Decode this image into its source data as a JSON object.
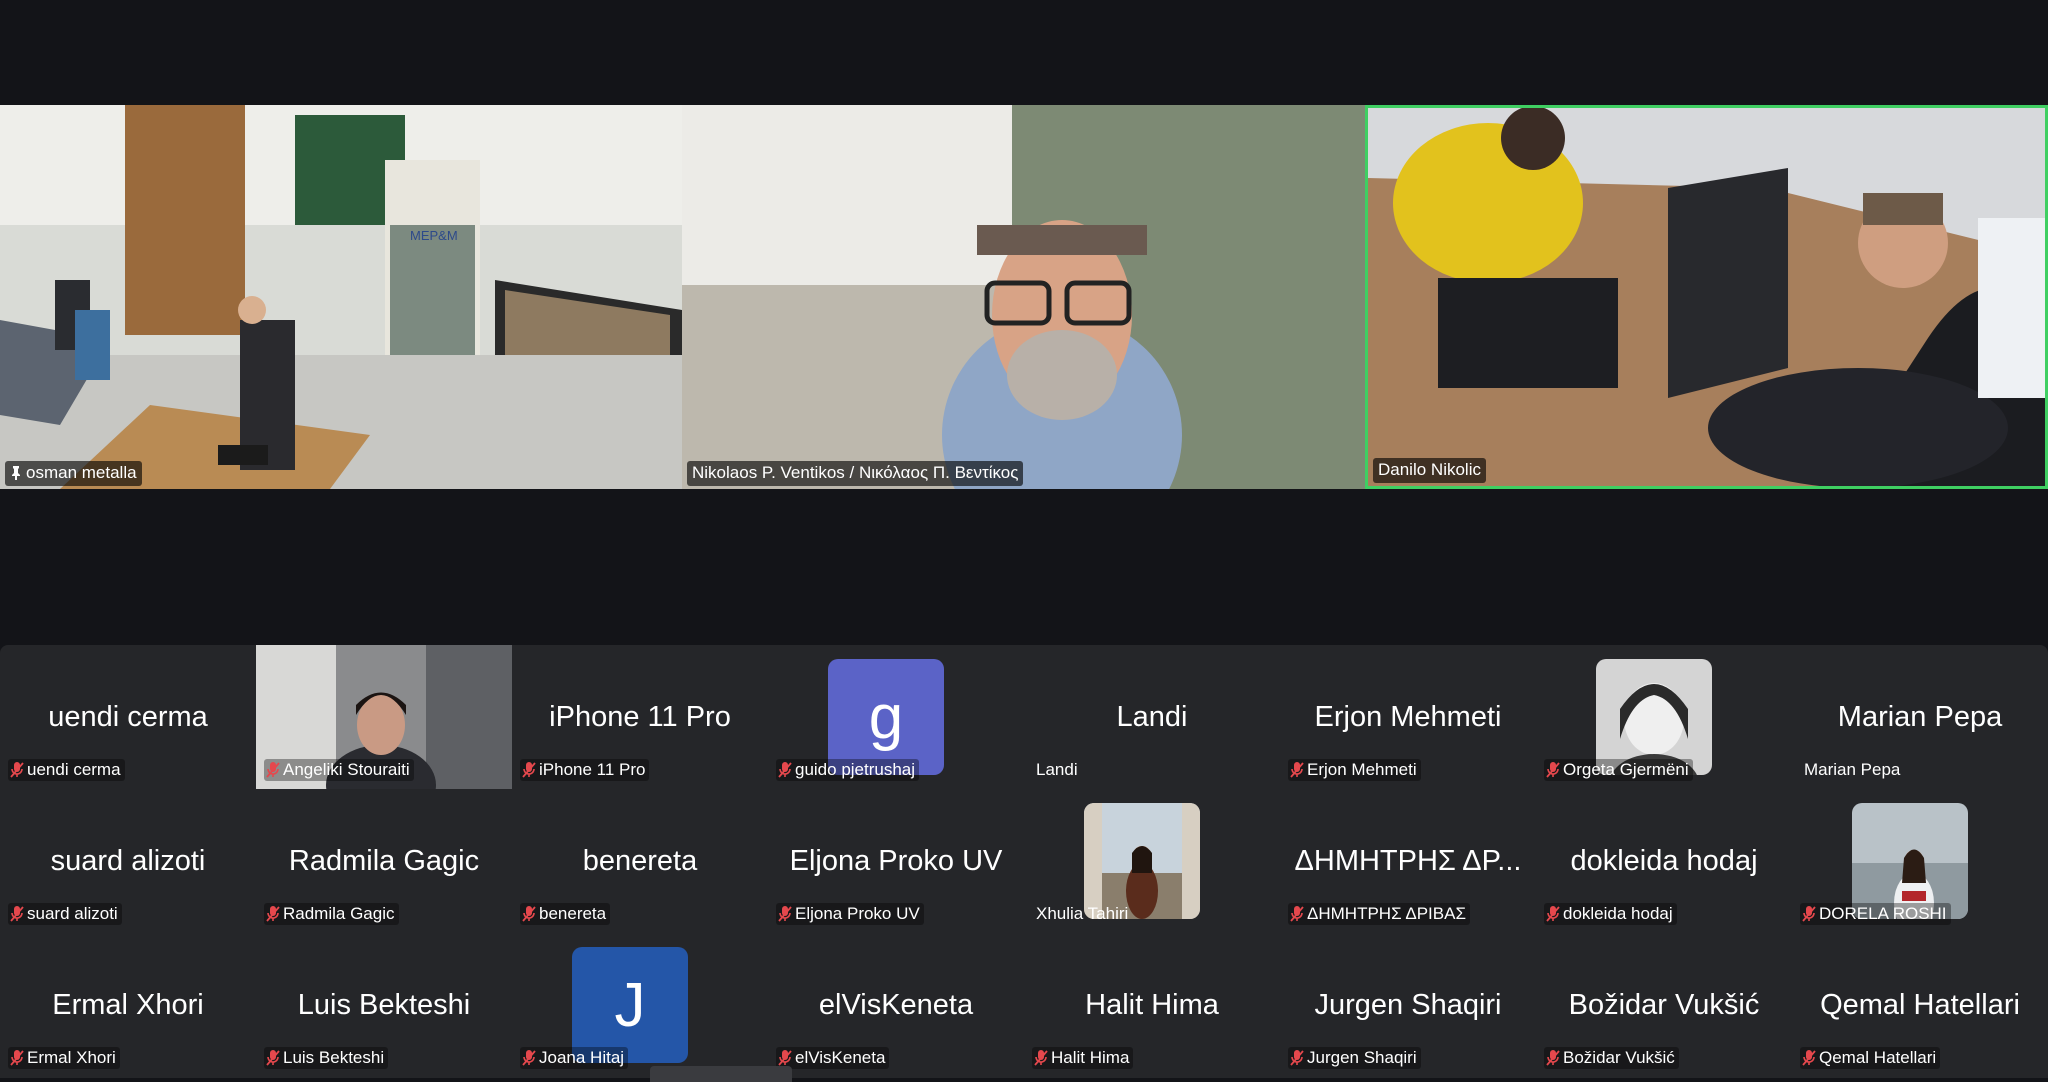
{
  "speakers": [
    {
      "name": "osman metalla",
      "pinned": true
    },
    {
      "name": "Nikolaos P. Ventikos / Νικόλαος Π. Βεντίκος",
      "pinned": false
    },
    {
      "name": "Danilo Nikolic",
      "pinned": false,
      "active": true
    }
  ],
  "gallery": {
    "rows": [
      [
        {
          "display": "uendi cerma",
          "label": "uendi cerma",
          "muted": true,
          "kind": "text"
        },
        {
          "display": "",
          "label": "Angeliki Stouraiti",
          "muted": true,
          "kind": "video"
        },
        {
          "display": "iPhone 11 Pro",
          "label": "iPhone 11 Pro",
          "muted": true,
          "kind": "text"
        },
        {
          "display": "g",
          "label": "guido pjetrushaj",
          "muted": true,
          "kind": "letter",
          "color": "#5b63c7"
        },
        {
          "display": "Landi",
          "label": "Landi",
          "muted": false,
          "kind": "text"
        },
        {
          "display": "Erjon Mehmeti",
          "label": "Erjon Mehmeti",
          "muted": true,
          "kind": "text"
        },
        {
          "display": "",
          "label": "Orgeta Gjermëni",
          "muted": true,
          "kind": "photo-bw"
        },
        {
          "display": "Marian Pepa",
          "label": "Marian Pepa",
          "muted": false,
          "kind": "text"
        }
      ],
      [
        {
          "display": "suard alizoti",
          "label": "suard alizoti",
          "muted": true,
          "kind": "text"
        },
        {
          "display": "Radmila Gagic",
          "label": "Radmila Gagic",
          "muted": true,
          "kind": "text"
        },
        {
          "display": "benereta",
          "label": "benereta",
          "muted": true,
          "kind": "text"
        },
        {
          "display": "Eljona Proko UV",
          "label": "Eljona Proko UV",
          "muted": true,
          "kind": "text"
        },
        {
          "display": "",
          "label": "Xhulia Tahiri",
          "muted": false,
          "kind": "photo-city"
        },
        {
          "display": "ΔΗΜΗΤΡΗΣ ΔΡ...",
          "label": "ΔΗΜΗΤΡΗΣ ΔΡΙΒΑΣ",
          "muted": true,
          "kind": "text"
        },
        {
          "display": "dokleida hodaj",
          "label": "dokleida hodaj",
          "muted": true,
          "kind": "text"
        },
        {
          "display": "",
          "label": "DORELA ROSHI",
          "muted": true,
          "kind": "photo-sea"
        }
      ],
      [
        {
          "display": "Ermal Xhori",
          "label": "Ermal Xhori",
          "muted": true,
          "kind": "text"
        },
        {
          "display": "Luis Bekteshi",
          "label": "Luis Bekteshi",
          "muted": true,
          "kind": "text"
        },
        {
          "display": "J",
          "label": "Joana Hitaj",
          "muted": true,
          "kind": "letter",
          "color": "#2456a8"
        },
        {
          "display": "elVisKeneta",
          "label": "elVisKeneta",
          "muted": true,
          "kind": "text"
        },
        {
          "display": "Halit Hima",
          "label": "Halit Hima",
          "muted": true,
          "kind": "text"
        },
        {
          "display": "Jurgen Shaqiri",
          "label": "Jurgen Shaqiri",
          "muted": true,
          "kind": "text"
        },
        {
          "display": "Božidar Vukšić",
          "label": "Božidar Vukšić",
          "muted": true,
          "kind": "text"
        },
        {
          "display": "Qemal Hatellari",
          "label": "Qemal Hatellari",
          "muted": true,
          "kind": "text"
        }
      ]
    ]
  },
  "colors": {
    "active_border": "#3fcf62",
    "muted_mic": "#e5484d",
    "gallery_bg": "#252629",
    "page_bg": "#131418"
  }
}
